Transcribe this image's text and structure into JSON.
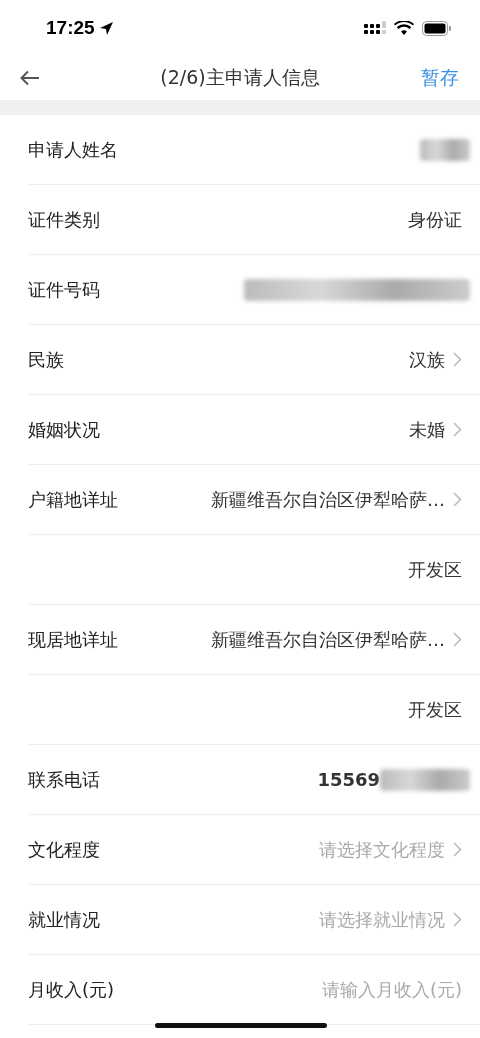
{
  "status_bar": {
    "time": "17:25"
  },
  "header": {
    "title": "(2/6)主申请人信息",
    "action": "暂存"
  },
  "rows": [
    {
      "kind": "hidden",
      "label": "申请人姓名"
    },
    {
      "kind": "text",
      "label": "证件类别",
      "value": "身份证"
    },
    {
      "kind": "id",
      "label": "证件号码"
    },
    {
      "kind": "select",
      "label": "民族",
      "value": "汉族"
    },
    {
      "kind": "select",
      "label": "婚姻状况",
      "value": "未婚"
    },
    {
      "kind": "select",
      "label": "户籍地详址",
      "value": "新疆维吾尔自治区伊犁哈萨…"
    },
    {
      "kind": "continuation",
      "value": "开发区"
    },
    {
      "kind": "select",
      "label": "现居地详址",
      "value": "新疆维吾尔自治区伊犁哈萨…"
    },
    {
      "kind": "continuation",
      "value": "开发区"
    },
    {
      "kind": "phone",
      "label": "联系电话",
      "value": "15569"
    },
    {
      "kind": "select",
      "label": "文化程度",
      "placeholder": "请选择文化程度"
    },
    {
      "kind": "select",
      "label": "就业情况",
      "placeholder": "请选择就业情况"
    },
    {
      "kind": "input",
      "label": "月收入(元)",
      "placeholder": "请输入月收入(元)"
    }
  ]
}
